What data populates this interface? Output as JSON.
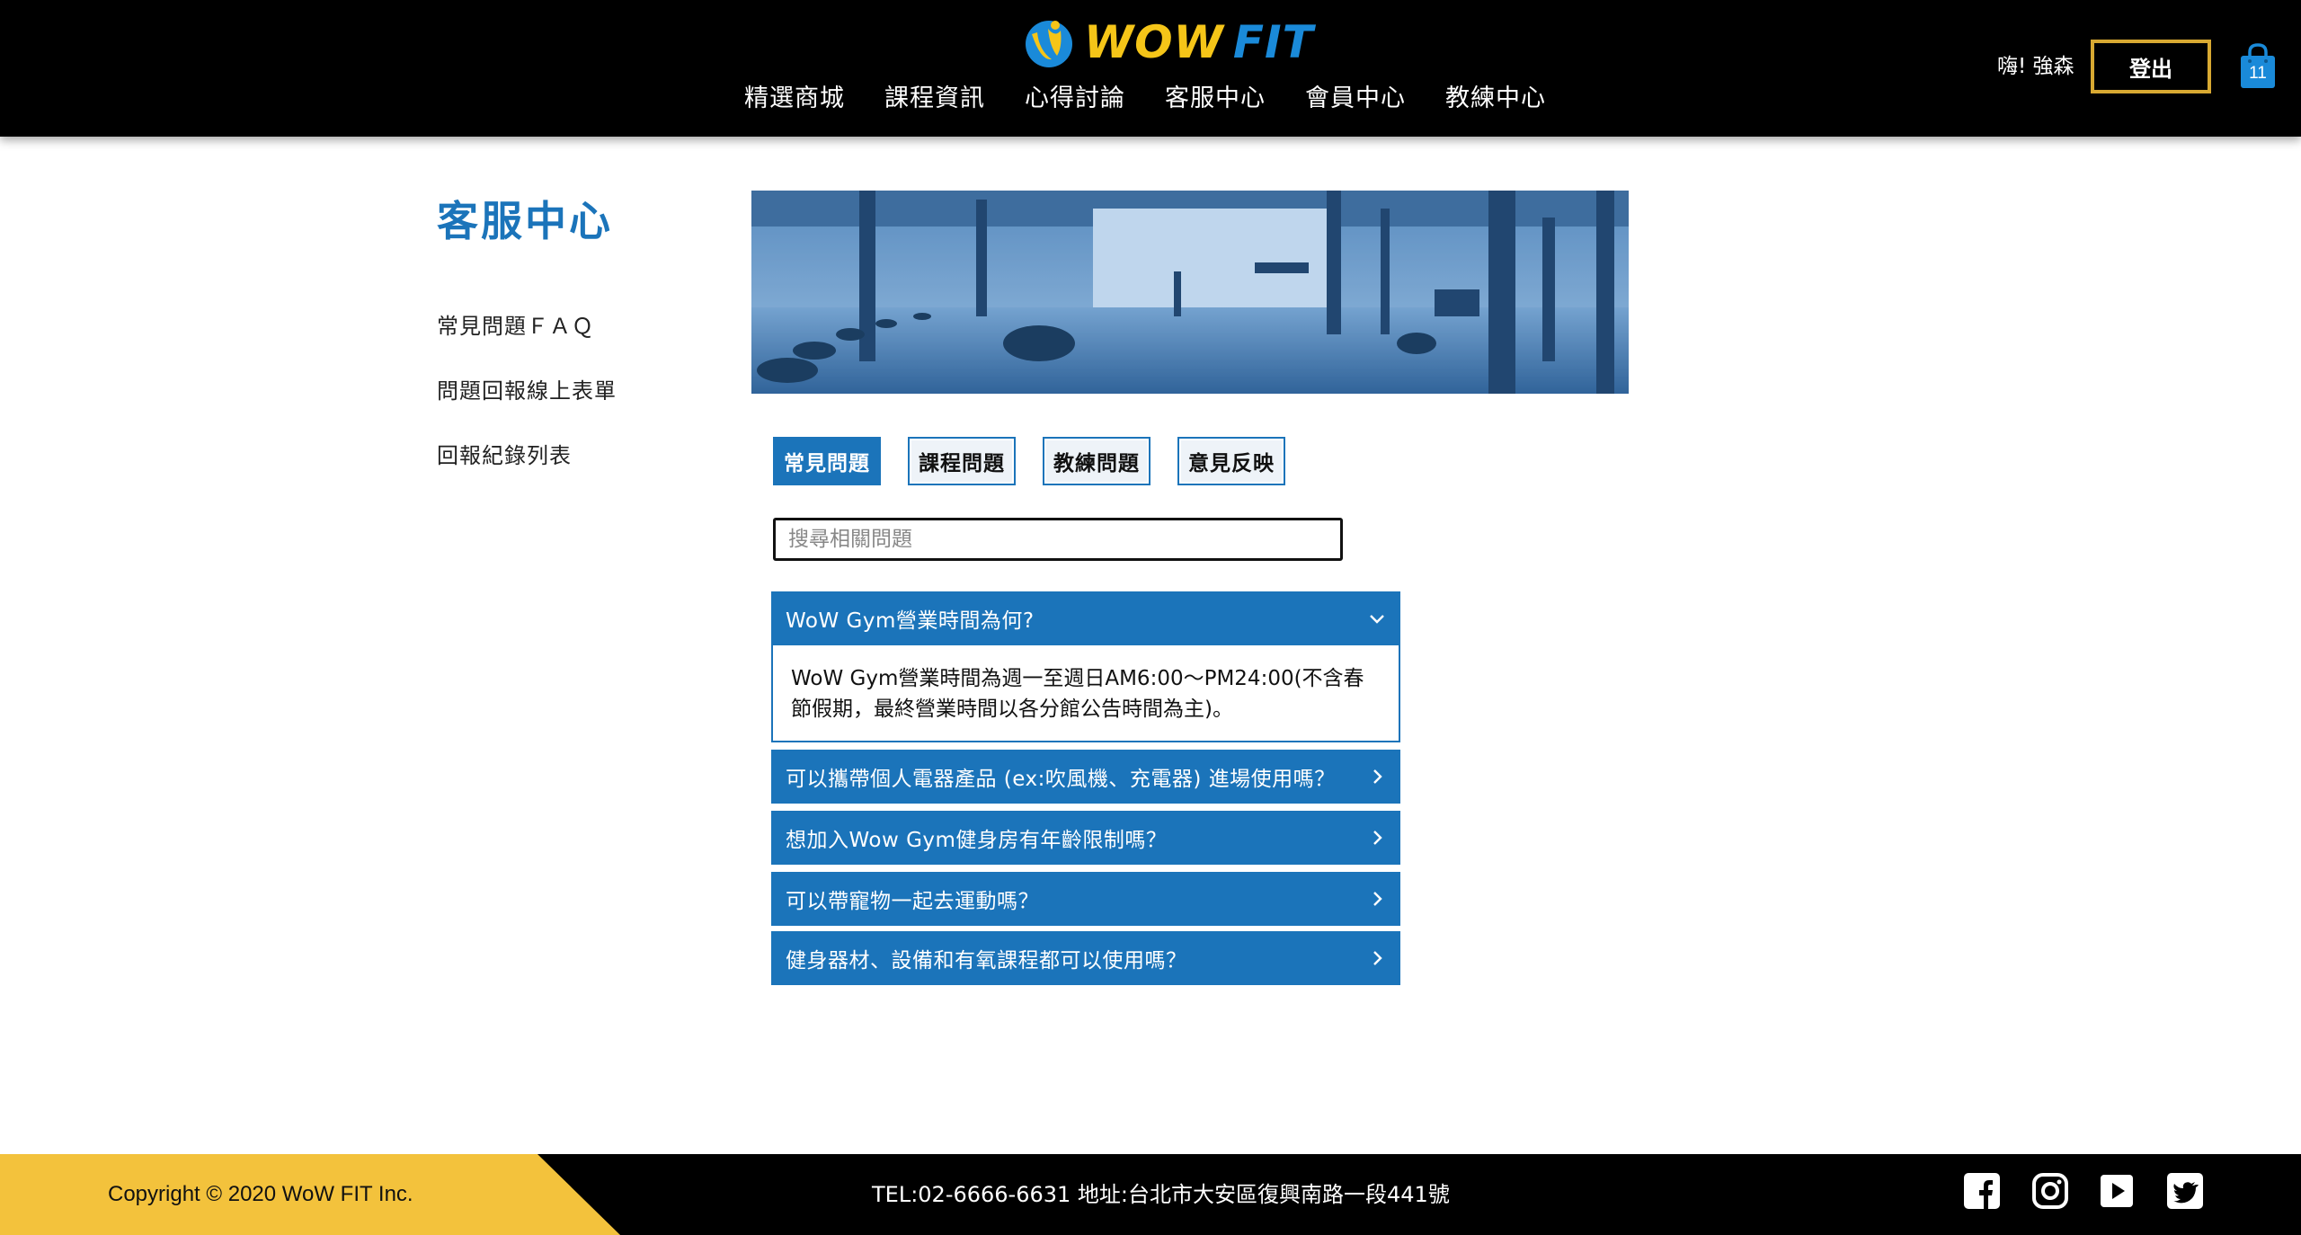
{
  "header": {
    "logo_wow": "WOW",
    "logo_fit": "FIT",
    "nav": [
      "精選商城",
      "課程資訊",
      "心得討論",
      "客服中心",
      "會員中心",
      "教練中心"
    ],
    "greeting": "嗨! 強森",
    "logout_label": "登出",
    "cart_count": "11"
  },
  "sidebar": {
    "title": "客服中心",
    "links": [
      "常見問題ＦＡＱ",
      "問題回報線上表單",
      "回報紀錄列表"
    ]
  },
  "tabs": [
    {
      "label": "常見問題",
      "active": true
    },
    {
      "label": "課程問題",
      "active": false
    },
    {
      "label": "教練問題",
      "active": false
    },
    {
      "label": "意見反映",
      "active": false
    }
  ],
  "search": {
    "placeholder": "搜尋相關問題",
    "value": ""
  },
  "faq": [
    {
      "q": "WoW Gym營業時間為何?",
      "expanded": true,
      "a_line1": "WoW Gym營業時間為週一至週日AM6:00～PM24:00(不含春",
      "a_line2": "節假期，最終營業時間以各分館公告時間為主)。"
    },
    {
      "q": "可以攜帶個人電器產品 (ex:吹風機、充電器) 進場使用嗎？",
      "expanded": false
    },
    {
      "q": "想加入Wow Gym健身房有年齡限制嗎？",
      "expanded": false
    },
    {
      "q": "可以帶寵物一起去運動嗎？",
      "expanded": false
    },
    {
      "q": "健身器材、設備和有氧課程都可以使用嗎？",
      "expanded": false
    }
  ],
  "footer": {
    "copyright": "Copyright © 2020 WoW FIT Inc.",
    "contact": "TEL:02-6666-6631 地址:台北市大安區復興南路一段441號",
    "social": [
      "facebook-icon",
      "instagram-icon",
      "youtube-icon",
      "twitter-icon"
    ]
  },
  "colors": {
    "brand_blue": "#1b74ba",
    "brand_yellow": "#f5c518",
    "footer_yellow": "#f3c23c",
    "logout_border": "#d8a932"
  }
}
